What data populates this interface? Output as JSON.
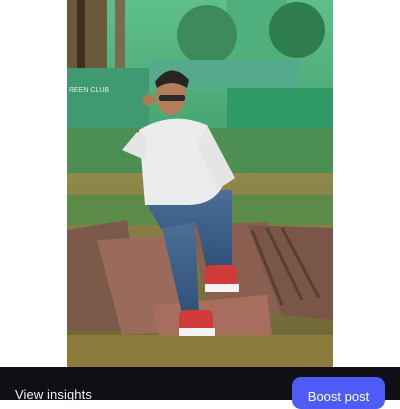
{
  "post": {
    "wall_sign_text": "REEN CLUB"
  },
  "actions": {
    "insights_label": "View insights",
    "boost_label": "Boost post"
  },
  "colors": {
    "bottom_bar": "#0f0f16",
    "boost_button": "#4e5bf6"
  }
}
